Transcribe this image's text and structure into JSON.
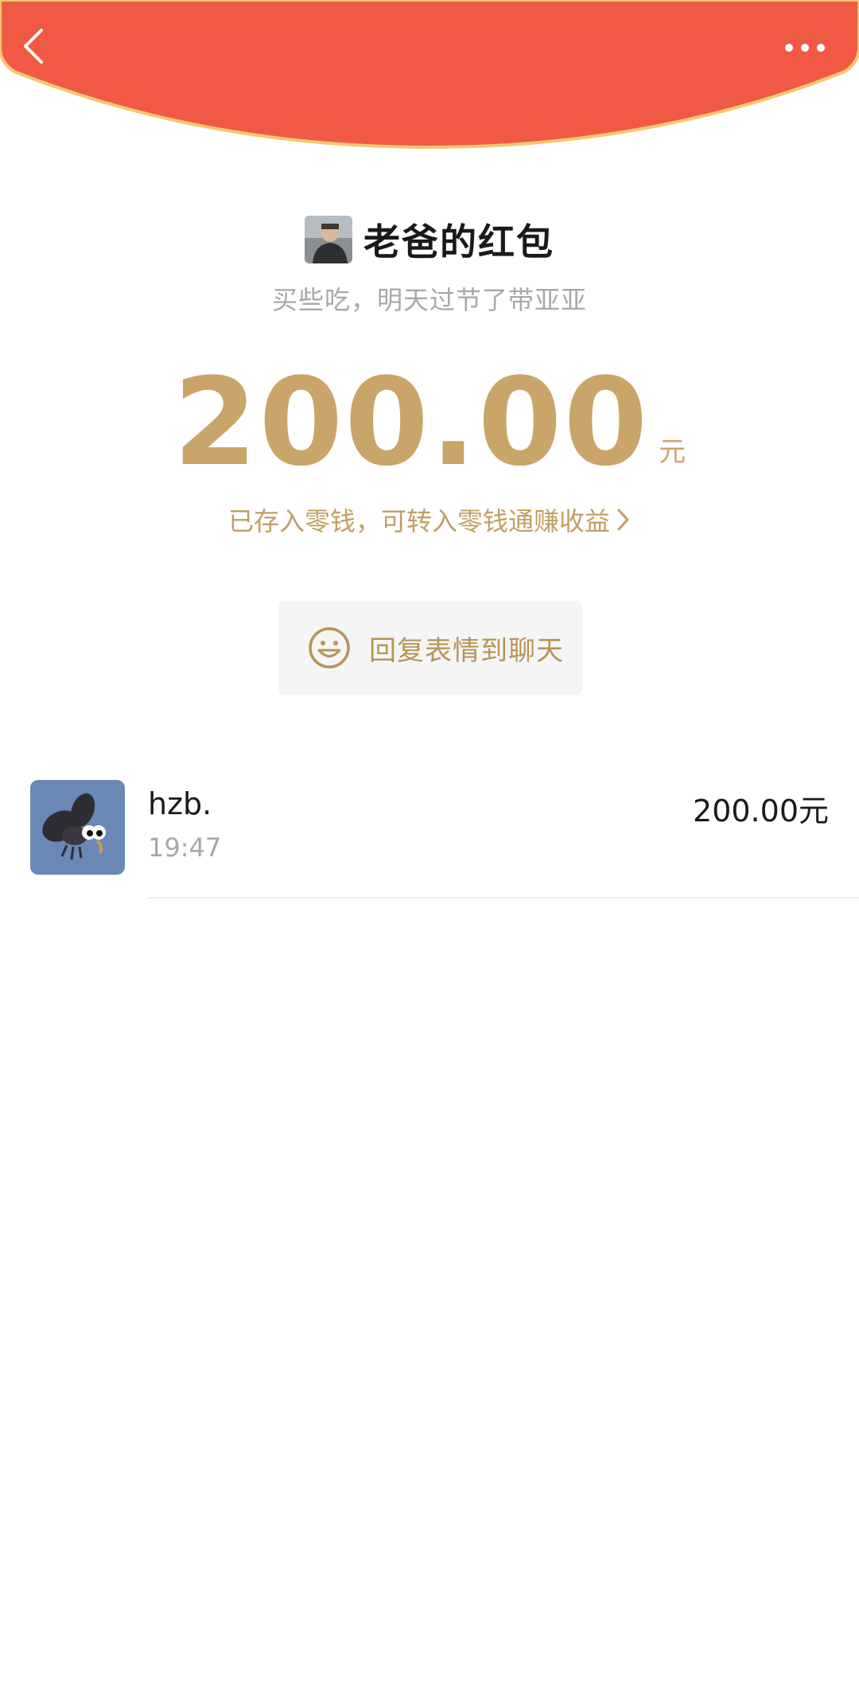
{
  "header": {
    "bg_color": "#f05a44",
    "border_color": "#f2c873",
    "back_icon": "chevron-left-icon",
    "more_icon": "more-dots-icon"
  },
  "packet": {
    "sender_title": "老爸的红包",
    "wish": "买些吃，明天过节了带亚亚",
    "amount": "200.00",
    "unit": "元",
    "deposit_note": "已存入零钱，可转入零钱通赚收益",
    "reply_label": "回复表情到聊天",
    "accent_color": "#caa56a"
  },
  "records": [
    {
      "name": "hzb.",
      "time": "19:47",
      "amount": "200.00元"
    }
  ]
}
